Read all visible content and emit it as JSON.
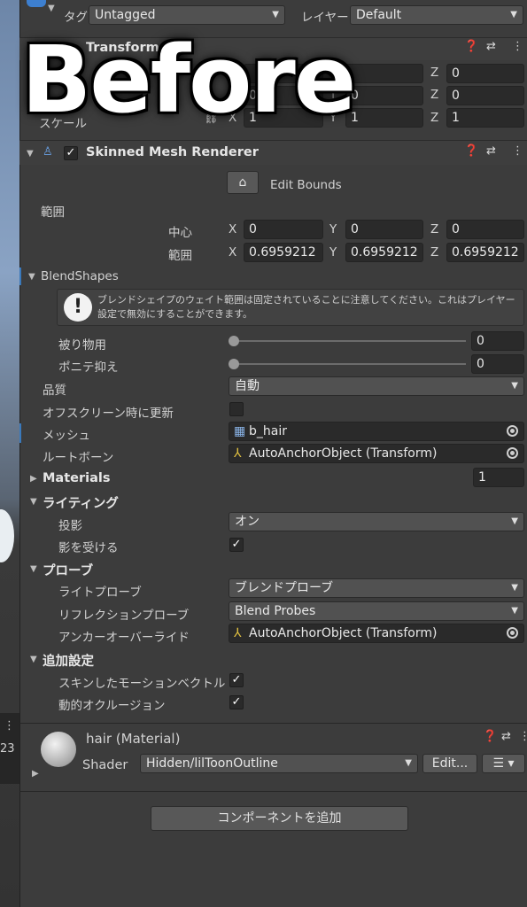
{
  "header": {
    "tag_label": "タグ",
    "tag_value": "Untagged",
    "layer_label": "レイヤー",
    "layer_value": "Default"
  },
  "transform": {
    "title": "Transform",
    "row3_label": "スケール",
    "x_label": "X",
    "y_label": "Y",
    "z_label": "Z",
    "pos": {
      "x": "",
      "y": "",
      "z": "0"
    },
    "rot": {
      "x": "0",
      "y": "0",
      "z": "0"
    },
    "scale": {
      "x": "1",
      "y": "1",
      "z": "1"
    }
  },
  "overlay_text": "Before",
  "smr": {
    "title": "Skinned Mesh Renderer",
    "edit_bounds": "Edit Bounds",
    "bounds_label": "範囲",
    "center_label": "中心",
    "extent_label": "範囲",
    "center": {
      "x": "0",
      "y": "0",
      "z": "0"
    },
    "extent": {
      "x": "0.6959212",
      "y": "0.6959212",
      "z": "0.6959212"
    },
    "blendshapes_label": "BlendShapes",
    "warning": "ブレンドシェイプのウェイト範囲は固定されていることに注意してください。これはプレイヤー設定で無効にすることができます。",
    "shapes": [
      {
        "label": "被り物用",
        "value": "0"
      },
      {
        "label": "ポニテ抑え",
        "value": "0"
      }
    ],
    "quality_label": "品質",
    "quality_value": "自動",
    "offscreen_label": "オフスクリーン時に更新",
    "mesh_label": "メッシュ",
    "mesh_value": "b_hair",
    "rootbone_label": "ルートボーン",
    "rootbone_value": "AutoAnchorObject (Transform)",
    "materials_label": "Materials",
    "materials_count": "1",
    "lighting_label": "ライティング",
    "cast_label": "投影",
    "cast_value": "オン",
    "receive_label": "影を受ける",
    "probes_label": "プローブ",
    "lightprobe_label": "ライトプローブ",
    "lightprobe_value": "ブレンドプローブ",
    "reflprobe_label": "リフレクションプローブ",
    "reflprobe_value": "Blend Probes",
    "anchor_label": "アンカーオーバーライド",
    "anchor_value": "AutoAnchorObject (Transform)",
    "additional_label": "追加設定",
    "skinned_motion_label": "スキンしたモーションベクトル",
    "dyn_occlusion_label": "動的オクルージョン"
  },
  "material": {
    "title": "hair (Material)",
    "shader_label": "Shader",
    "shader_value": "Hidden/lilToonOutline",
    "edit_label": "Edit..."
  },
  "add_component": "コンポーネントを追加",
  "scene": {
    "number": "23",
    "dots": "⋮"
  },
  "colors": {
    "accent": "#3a79bb",
    "panel": "#3c3c3c",
    "field": "#2a2a2a"
  }
}
